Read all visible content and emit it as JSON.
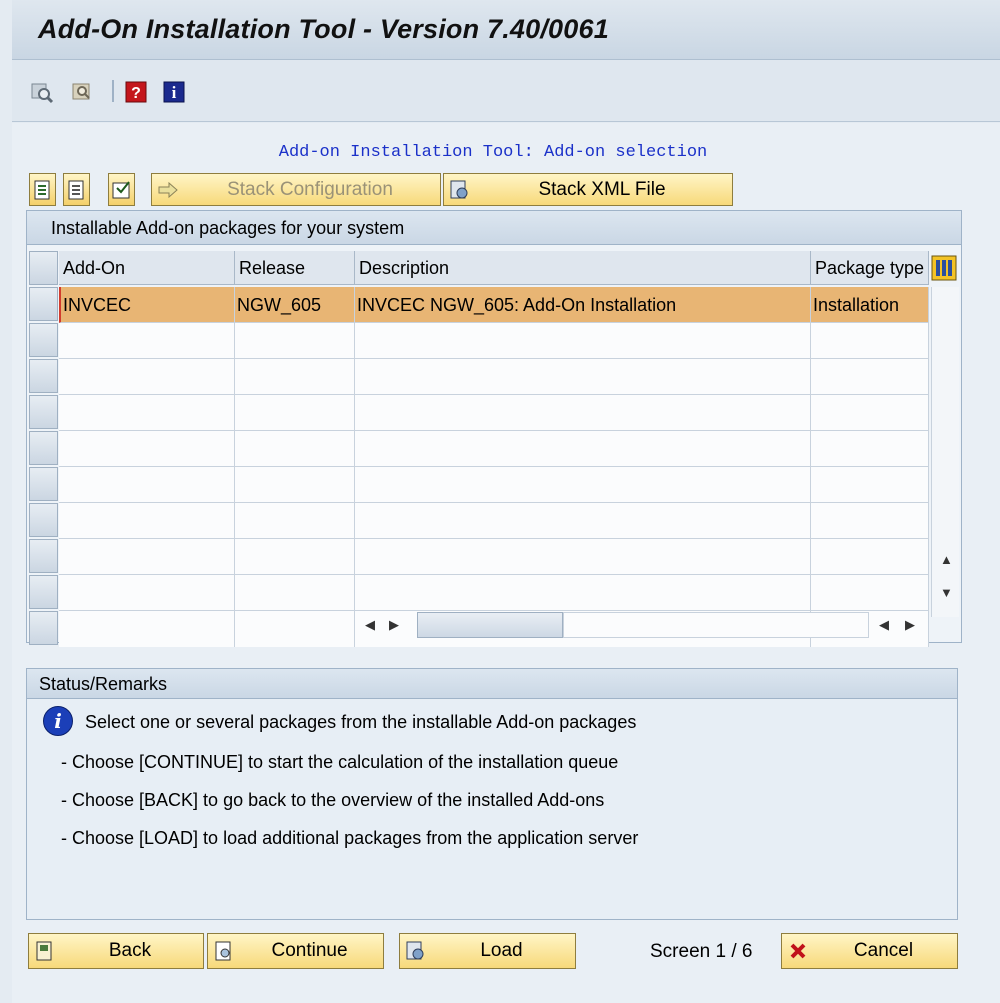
{
  "window": {
    "title": "Add-On Installation Tool - Version 7.40/0061"
  },
  "toolbar": {
    "icons": [
      "find-icon",
      "find-next-icon",
      "help-icon",
      "info-icon"
    ]
  },
  "heading": "Add-on Installation Tool: Add-on selection",
  "action_buttons": {
    "stack_config_label": "Stack Configuration",
    "stack_xml_label": "Stack XML File"
  },
  "table": {
    "title": "Installable Add-on packages for your system",
    "columns": [
      "Add-On",
      "Release",
      "Description",
      "Package type"
    ],
    "rows": [
      {
        "addon": "INVCEC",
        "release": "NGW_605",
        "description": "INVCEC NGW_605: Add-On Installation",
        "package_type": "Installation"
      }
    ]
  },
  "status": {
    "title": "Status/Remarks",
    "lines": [
      "Select one or several packages from the installable Add-on packages",
      "- Choose [CONTINUE] to start the calculation of the installation queue",
      "- Choose [BACK] to go back to the overview of the installed Add-ons",
      "- Choose [LOAD] to load additional packages from the application server"
    ]
  },
  "footer": {
    "back_label": "Back",
    "continue_label": "Continue",
    "load_label": "Load",
    "screen_indicator": "Screen 1 / 6",
    "cancel_label": "Cancel"
  },
  "colors": {
    "selected_row": "#e8b574",
    "button_gradient_top": "#fff5c6",
    "button_gradient_bottom": "#f7d97a",
    "heading_text": "#1b31c9"
  }
}
